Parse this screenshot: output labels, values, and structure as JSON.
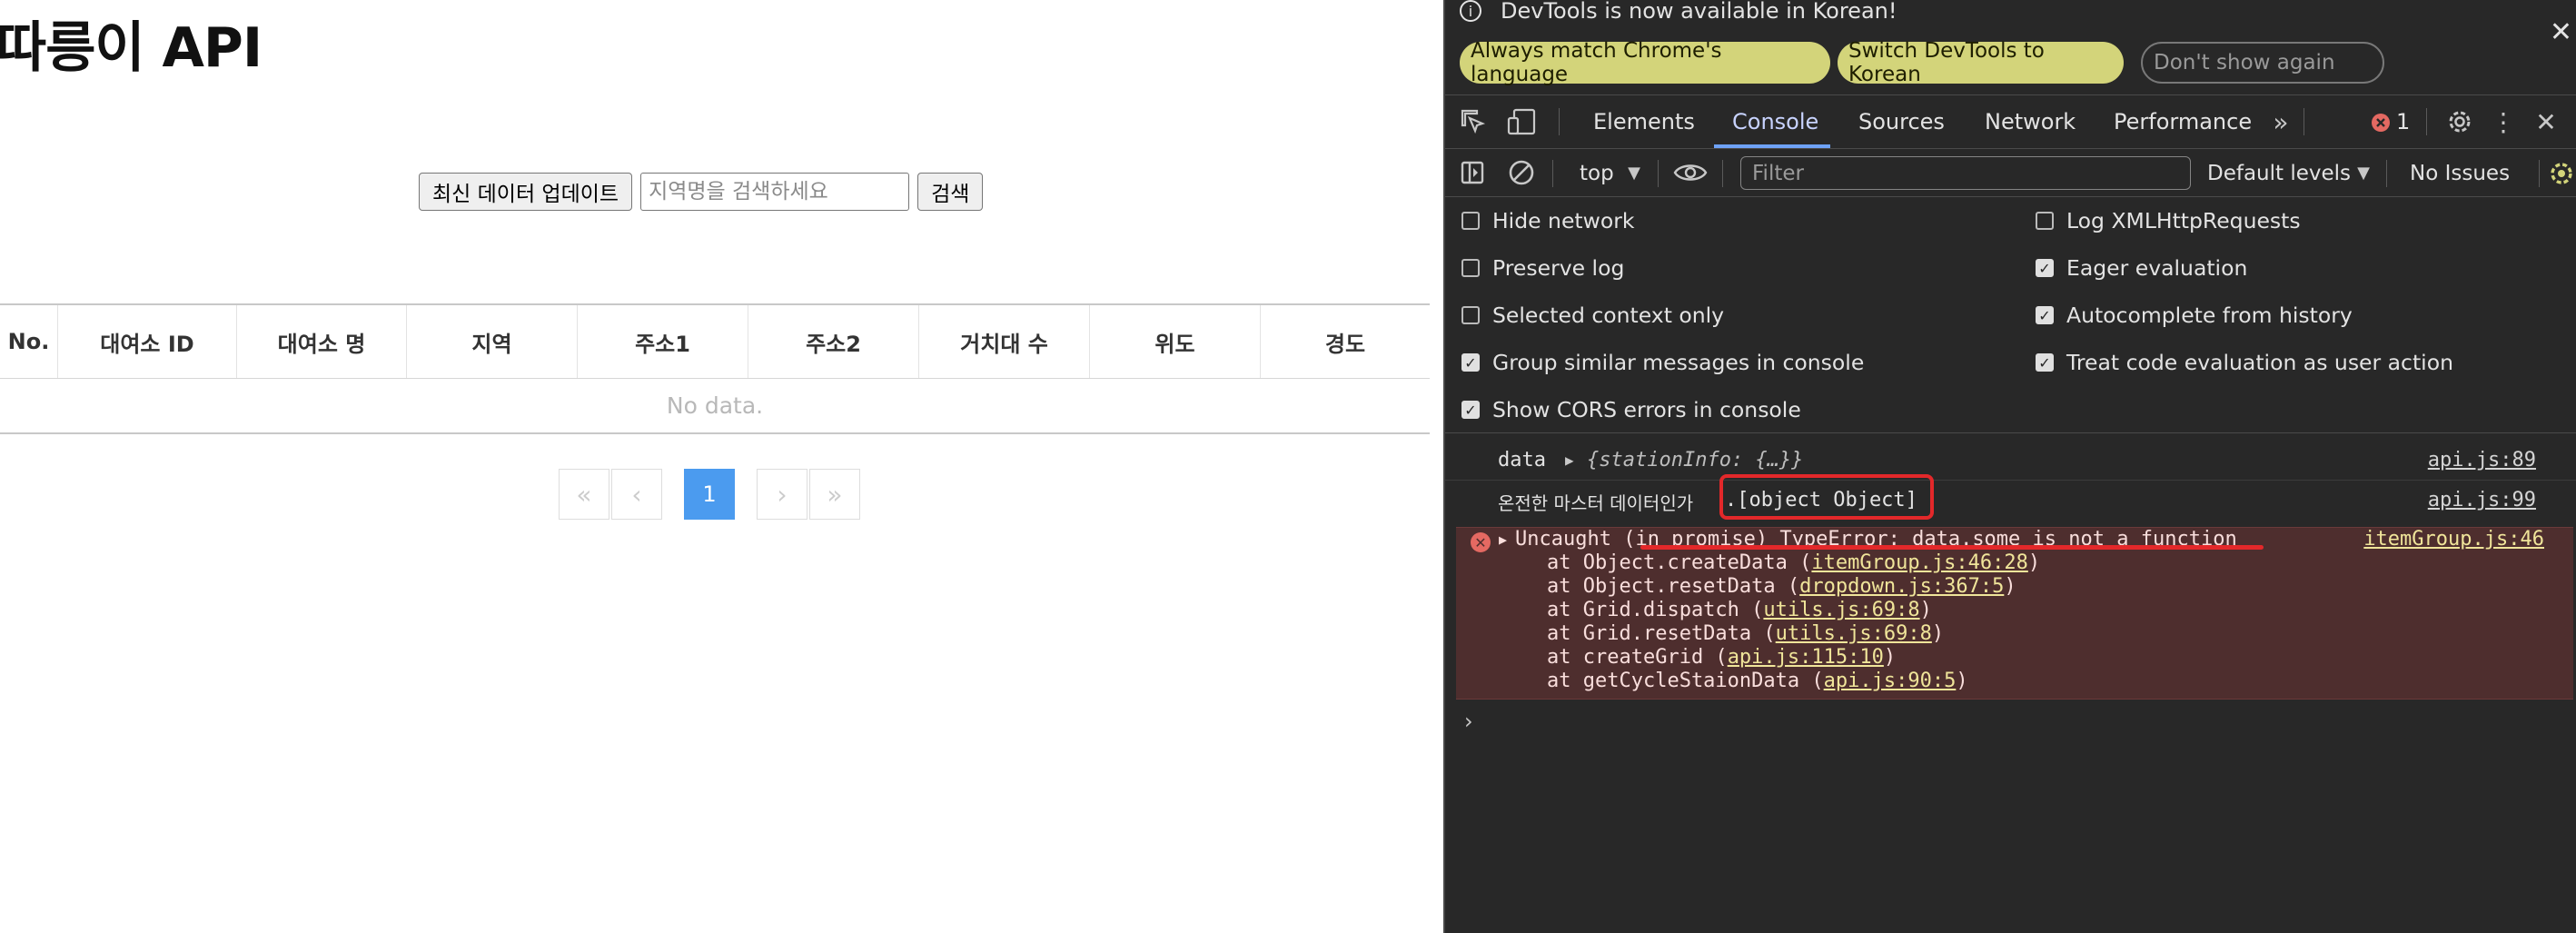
{
  "page": {
    "title": "따릉이 API",
    "update_button": "최신 데이터 업데이트",
    "search_placeholder": "지역명을 검색하세요",
    "search_button": "검색",
    "grid": {
      "columns": [
        "No.",
        "대여소 ID",
        "대여소 명",
        "지역",
        "주소1",
        "주소2",
        "거치대 수",
        "위도",
        "경도"
      ],
      "empty_text": "No data."
    },
    "pagination": {
      "first": "«",
      "prev": "‹",
      "current": "1",
      "next": "›",
      "last": "»"
    }
  },
  "devtools": {
    "info_bar": {
      "message": "DevTools is now available in Korean!",
      "always_match": "Always match Chrome's language",
      "switch": "Switch DevTools to Korean",
      "dont_show": "Don't show again"
    },
    "tabs": [
      "Elements",
      "Console",
      "Sources",
      "Network",
      "Performance"
    ],
    "active_tab": "Console",
    "error_count": "1",
    "console_toolbar": {
      "context": "top",
      "filter_placeholder": "Filter",
      "levels": "Default levels",
      "issues": "No Issues"
    },
    "settings_left": [
      {
        "label": "Hide network",
        "checked": false
      },
      {
        "label": "Preserve log",
        "checked": false
      },
      {
        "label": "Selected context only",
        "checked": false
      },
      {
        "label": "Group similar messages in console",
        "checked": true
      },
      {
        "label": "Show CORS errors in console",
        "checked": true
      }
    ],
    "settings_right": [
      {
        "label": "Log XMLHttpRequests",
        "checked": false
      },
      {
        "label": "Eager evaluation",
        "checked": true
      },
      {
        "label": "Autocomplete from history",
        "checked": true
      },
      {
        "label": "Treat code evaluation as user action",
        "checked": true
      }
    ],
    "logs": {
      "log1_label": "data",
      "log1_value": "{stationInfo: {…}}",
      "log1_source": "api.js:89",
      "log2_label": "온전한 마스터 데이터인가",
      "log2_value": ".[object Object]",
      "log2_source": "api.js:99",
      "error_message": "Uncaught (in promise) TypeError: data.some is not a function",
      "error_source": "itemGroup.js:46",
      "stack": [
        {
          "prefix": "at Object.createData (",
          "link": "itemGroup.js:46:28"
        },
        {
          "prefix": "at Object.resetData (",
          "link": "dropdown.js:367:5"
        },
        {
          "prefix": "at Grid.dispatch (",
          "link": "utils.js:69:8"
        },
        {
          "prefix": "at Grid.resetData (",
          "link": "utils.js:69:8"
        },
        {
          "prefix": "at createGrid (",
          "link": "api.js:115:10"
        },
        {
          "prefix": "at getCycleStaionData (",
          "link": "api.js:90:5"
        }
      ]
    },
    "prompt": "›"
  }
}
